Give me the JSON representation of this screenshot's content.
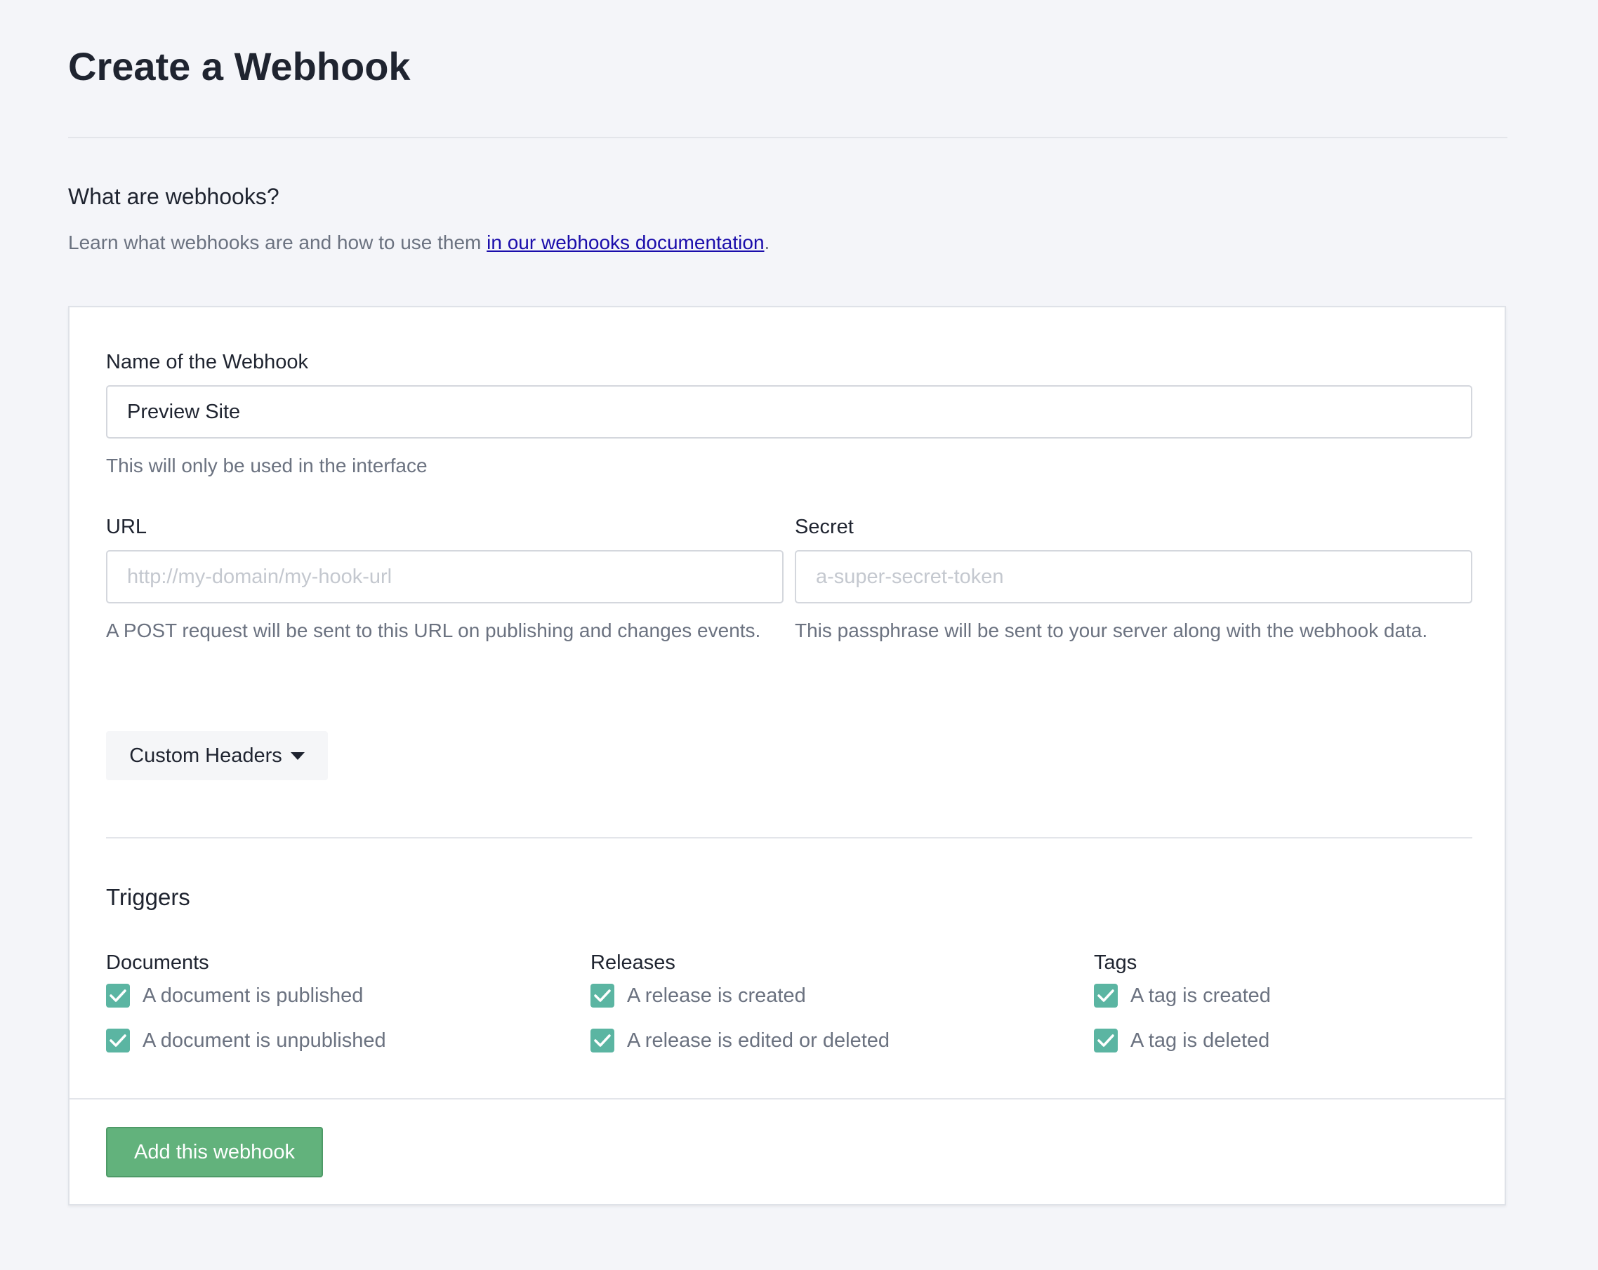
{
  "page": {
    "title": "Create a Webhook"
  },
  "intro": {
    "heading": "What are webhooks?",
    "text": "Learn what webhooks are and how to use them ",
    "link_text": "in our webhooks documentation",
    "suffix": "."
  },
  "form": {
    "name": {
      "label": "Name of the Webhook",
      "value": "Preview Site",
      "help": "This will only be used in the interface"
    },
    "url": {
      "label": "URL",
      "placeholder": "http://my-domain/my-hook-url",
      "value": "",
      "help": "A POST request will be sent to this URL on publishing and changes events."
    },
    "secret": {
      "label": "Secret",
      "placeholder": "a-super-secret-token",
      "value": "",
      "help": "This passphrase will be sent to your server along with the webhook data."
    },
    "custom_headers_label": "Custom Headers",
    "triggers": {
      "title": "Triggers",
      "groups": [
        {
          "title": "Documents",
          "items": [
            {
              "label": "A document is published",
              "checked": true
            },
            {
              "label": "A document is unpublished",
              "checked": true
            }
          ]
        },
        {
          "title": "Releases",
          "items": [
            {
              "label": "A release is created",
              "checked": true
            },
            {
              "label": "A release is edited or deleted",
              "checked": true
            }
          ]
        },
        {
          "title": "Tags",
          "items": [
            {
              "label": "A tag is created",
              "checked": true
            },
            {
              "label": "A tag is deleted",
              "checked": true
            }
          ]
        }
      ]
    },
    "submit_label": "Add this webhook"
  },
  "colors": {
    "checkbox": "#5bb5a2",
    "submit": "#62b27c",
    "link": "#1a0dab"
  },
  "icons": {
    "checkbox_checked": "checkmark-icon",
    "dropdown": "caret-down-icon"
  }
}
